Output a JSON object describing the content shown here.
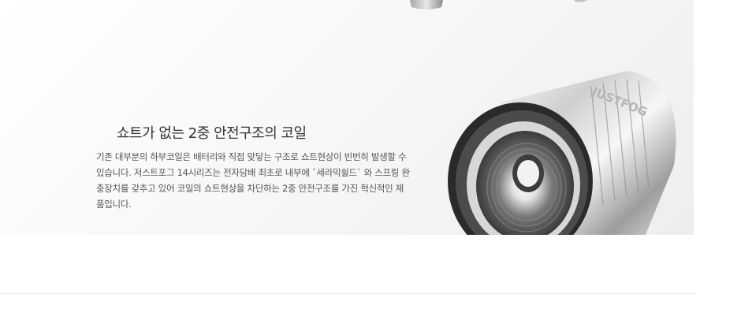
{
  "feature": {
    "title": "쇼트가 없는 2중 안전구조의 코일",
    "description": "기존 대부분의 하부코일은 배터리와 직접 맞닿는 구조로 쇼트현상이 빈번히 발생할 수 있습니다. 저스트포그 14시리즈는 전자담배 최초로 내부에 `세라믹쉴드` 와 스프링 완충장치를 갖추고 있어 코일의 쇼트현상을 차단하는 2중 안전구조를 가진 혁신적인 제품입니다.",
    "product_engraving": "JUSTFOG"
  }
}
